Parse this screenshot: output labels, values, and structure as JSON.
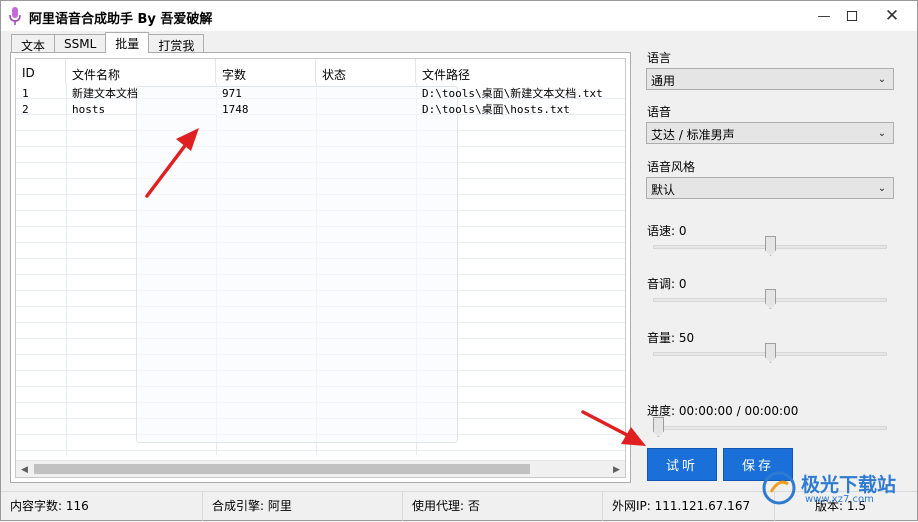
{
  "window": {
    "title": "阿里语音合成助手 By 吾爱破解"
  },
  "tabs": [
    "文本",
    "SSML",
    "批量",
    "打赏我"
  ],
  "list": {
    "columns": [
      "ID",
      "文件名称",
      "字数",
      "状态",
      "文件路径"
    ],
    "rows": [
      {
        "id": "1",
        "name": "新建文本文档",
        "count": "971",
        "status": "",
        "path": "D:\\tools\\桌面\\新建文本文档.txt"
      },
      {
        "id": "2",
        "name": "hosts",
        "count": "1748",
        "status": "",
        "path": "D:\\tools\\桌面\\hosts.txt"
      }
    ]
  },
  "settings": {
    "language_label": "语言",
    "language_value": "通用",
    "voice_label": "语音",
    "voice_value": "艾达 / 标准男声",
    "style_label": "语音风格",
    "style_value": "默认",
    "speed_label": "语速:",
    "speed_value": "0",
    "pitch_label": "音调:",
    "pitch_value": "0",
    "volume_label": "音量:",
    "volume_value": "50",
    "progress_label": "进度:",
    "progress_time": "00:00:00 / 00:00:00",
    "speed_fraction": 0.5,
    "pitch_fraction": 0.5,
    "volume_fraction": 0.5,
    "progress_fraction": 0.0
  },
  "buttons": {
    "preview": "试听",
    "save": "保存"
  },
  "status": {
    "chars_label": "内容字数:",
    "chars_value": "116",
    "engine_label": "合成引擎:",
    "engine_value": "阿里",
    "proxy_label": "使用代理:",
    "proxy_value": "否",
    "ip_label": "外网IP:",
    "ip_value": "111.121.67.167",
    "version_label": "版本:",
    "version_value": "1.5"
  },
  "watermark": {
    "text": "极光下载站",
    "sub": "www.xz7.com"
  },
  "colors": {
    "accent": "#1a6fd8",
    "arrow": "#e02020"
  }
}
